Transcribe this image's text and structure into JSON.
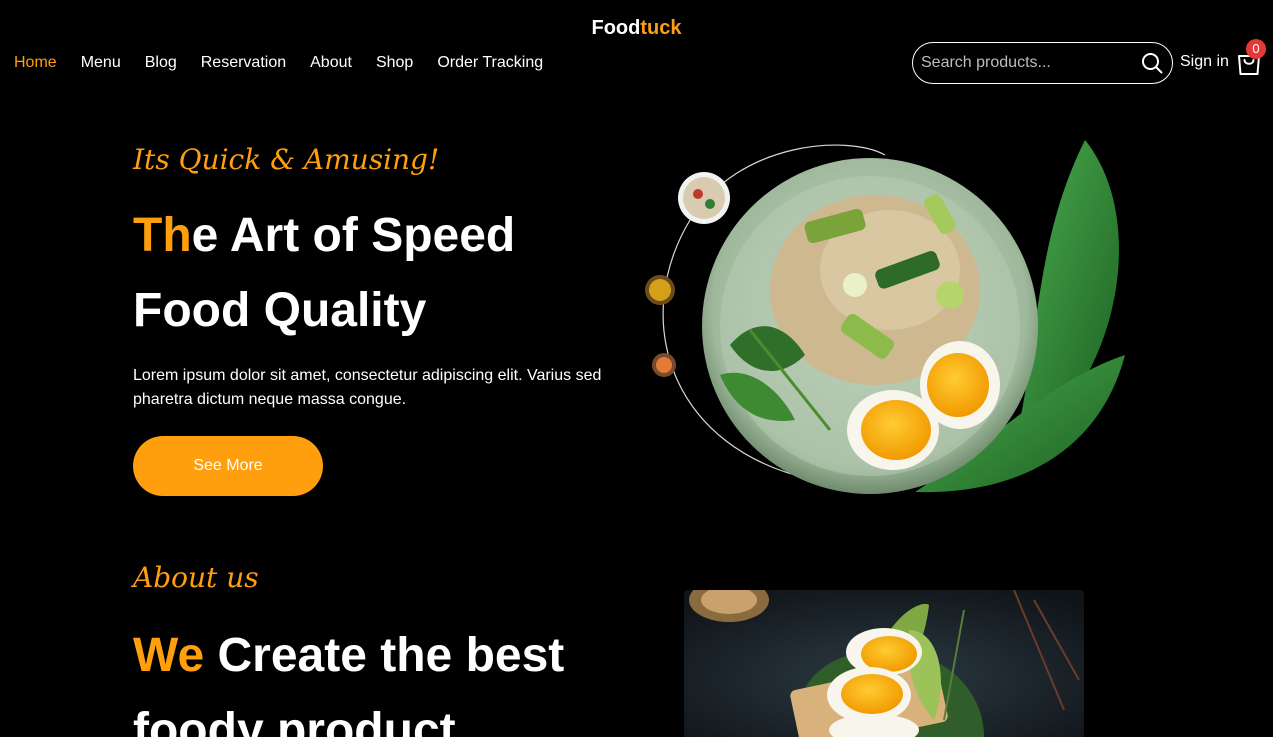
{
  "brand": {
    "name_main": "Food",
    "name_accent": "tuck"
  },
  "nav": {
    "items": [
      {
        "label": "Home",
        "active": true
      },
      {
        "label": "Menu"
      },
      {
        "label": "Blog"
      },
      {
        "label": "Reservation"
      },
      {
        "label": "About"
      },
      {
        "label": "Shop"
      },
      {
        "label": "Order Tracking"
      }
    ]
  },
  "search": {
    "placeholder": "Search products..."
  },
  "account": {
    "signin_label": "Sign in"
  },
  "cart": {
    "count": "0"
  },
  "hero": {
    "tagline": "Its Quick & Amusing!",
    "title_highlight": "Th",
    "title_rest_line1": "e Art of Speed",
    "title_line2": "Food Quality",
    "description": "Lorem ipsum dolor sit amet, consectetur adipiscing elit. Varius sed pharetra dictum neque massa congue.",
    "cta_label": "See More"
  },
  "about": {
    "tagline": "About us",
    "title_highlight": "We",
    "title_rest_line1": " Create the best",
    "title_line2": "foody product"
  },
  "colors": {
    "accent": "#ff9f0d",
    "background": "#000000",
    "badge": "#e53935"
  }
}
